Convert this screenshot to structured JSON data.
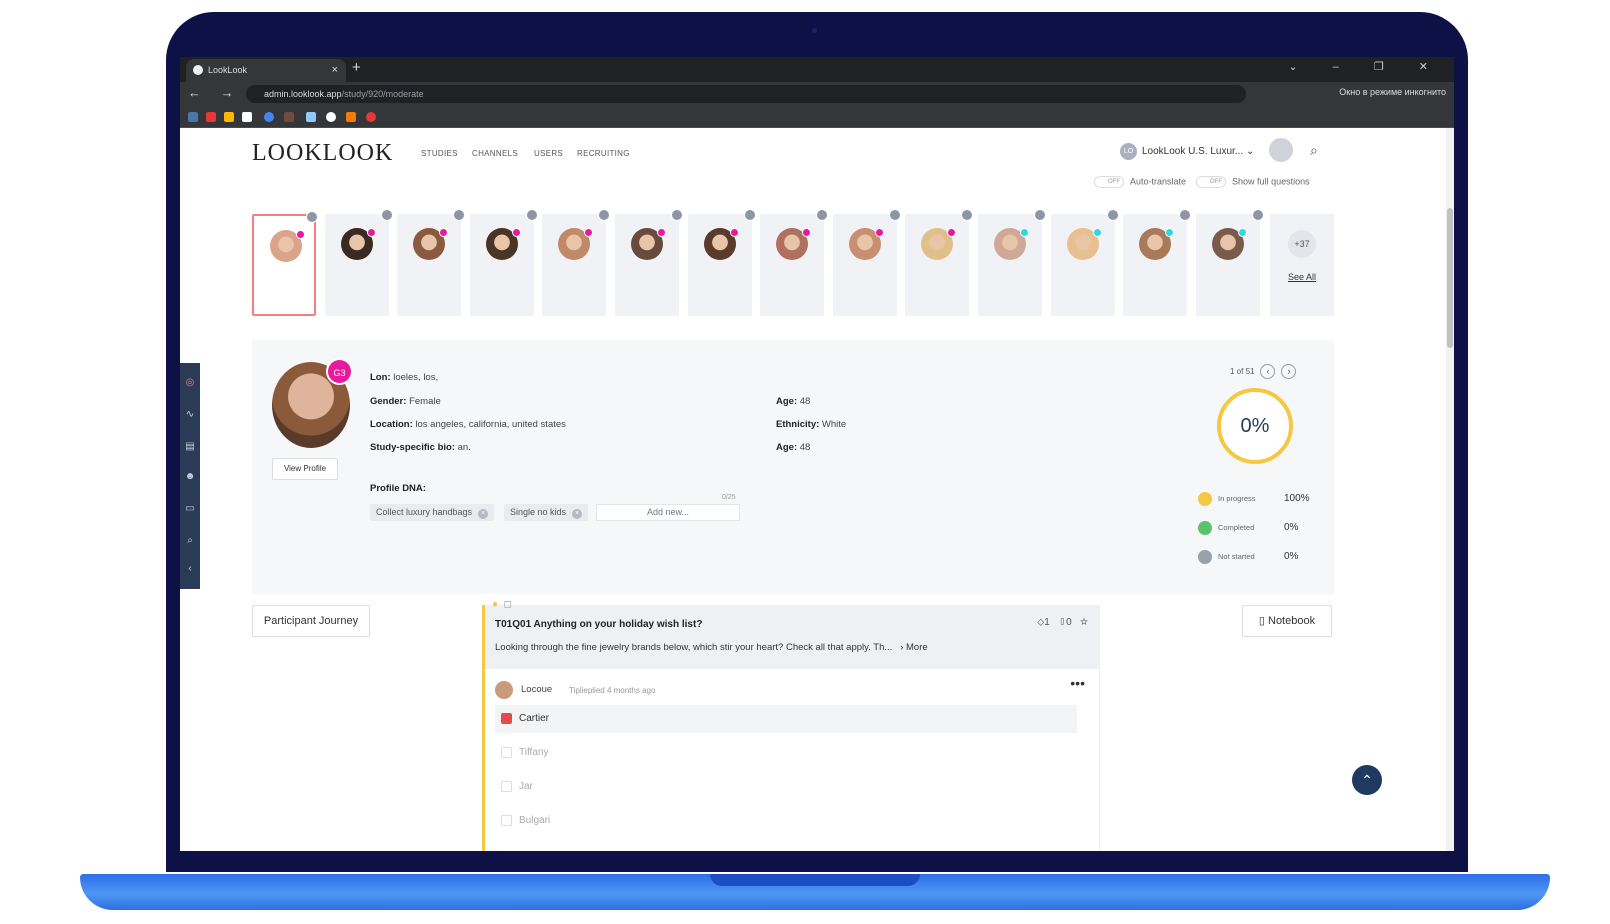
{
  "browser": {
    "tab_title": "LookLook",
    "tab_close": "×",
    "new_tab": "+",
    "window_controls": "⌄ – ❐ ✕",
    "nav_icons": "← → ⟳",
    "url_host": "admin.looklook.app",
    "url_path": "/study/920/moderate",
    "incognito_label": "Окно в режиме инкогнито"
  },
  "header": {
    "logo": "LOOKLOOK",
    "menu": [
      "STUDIES",
      "CHANNELS",
      "USERS",
      "RECRUITING"
    ],
    "account_badge": "LO",
    "account_name": "LookLook U.S. Luxur...",
    "account_caret": "⌄",
    "search_icon": "⌕"
  },
  "toggles": {
    "auto_translate_state": "OFF",
    "auto_translate_label": "Auto-translate",
    "full_questions_state": "OFF",
    "full_questions_label": "Show full questions"
  },
  "participants": {
    "see_more": "+37",
    "see_all": "See All",
    "faces": [
      "#d9a48a",
      "#3a2a22",
      "#8a5a40",
      "#4a3426",
      "#c08a6a",
      "#6a4a3a",
      "#5a3a2a",
      "#b07060",
      "#c89070",
      "#e0c08a",
      "#d0a898",
      "#e8c090",
      "#a87a5a",
      "#7a5a4a"
    ],
    "dots": [
      "#e9199e",
      "#e9199e",
      "#e9199e",
      "#e9199e",
      "#e9199e",
      "#e9199e",
      "#e9199e",
      "#e9199e",
      "#e9199e",
      "#e9199e",
      "#2bd9e6",
      "#2bd9e6",
      "#2bd9e6",
      "#2bd9e6"
    ]
  },
  "profile": {
    "badge": "G3",
    "view_profile": "View Profile",
    "lon_label": "Lon:",
    "lon_value": "loeles, los,",
    "gender_label": "Gender:",
    "gender_value": "Female",
    "location_label": "Location:",
    "location_value": "los angeles, california, united states",
    "bio_label": "Study-specific bio:",
    "bio_value": "an.",
    "age_label": "Age:",
    "age_value": "48",
    "ethnicity_label": "Ethnicity:",
    "ethnicity_value": "White",
    "age2_label": "Age:",
    "age2_value": "48",
    "dna_label": "Profile DNA:",
    "dna_count": "0/25",
    "chips": [
      "Collect luxury handbags",
      "Single no kids"
    ],
    "chip_remove": "×",
    "add_new": "Add new..."
  },
  "progress": {
    "pager": "1 of 51",
    "prev": "‹",
    "next": "›",
    "percent": "0%",
    "stats": [
      {
        "label": "In progress",
        "value": "100%",
        "color": "#f5c842"
      },
      {
        "label": "Completed",
        "value": "0%",
        "color": "#5cc36a"
      },
      {
        "label": "Not started",
        "value": "0%",
        "color": "#9aa0aa"
      }
    ]
  },
  "journey": {
    "participant_journey": "Participant Journey",
    "notebook": "Notebook",
    "question_title": "T01Q01 Anything on your holiday wish list?",
    "question_text": "Looking through the fine jewelry brands below, which stir your heart? Check all that apply. Th...",
    "more_link": "› More",
    "tag_count": "1",
    "doc_count": "0",
    "answer_name": "Locoue",
    "answer_meta": "Tiplieplied 4 months ago",
    "menu_dots": "•••",
    "options": [
      "Cartier",
      "Tiffany",
      "Jar",
      "Bulgari"
    ]
  }
}
